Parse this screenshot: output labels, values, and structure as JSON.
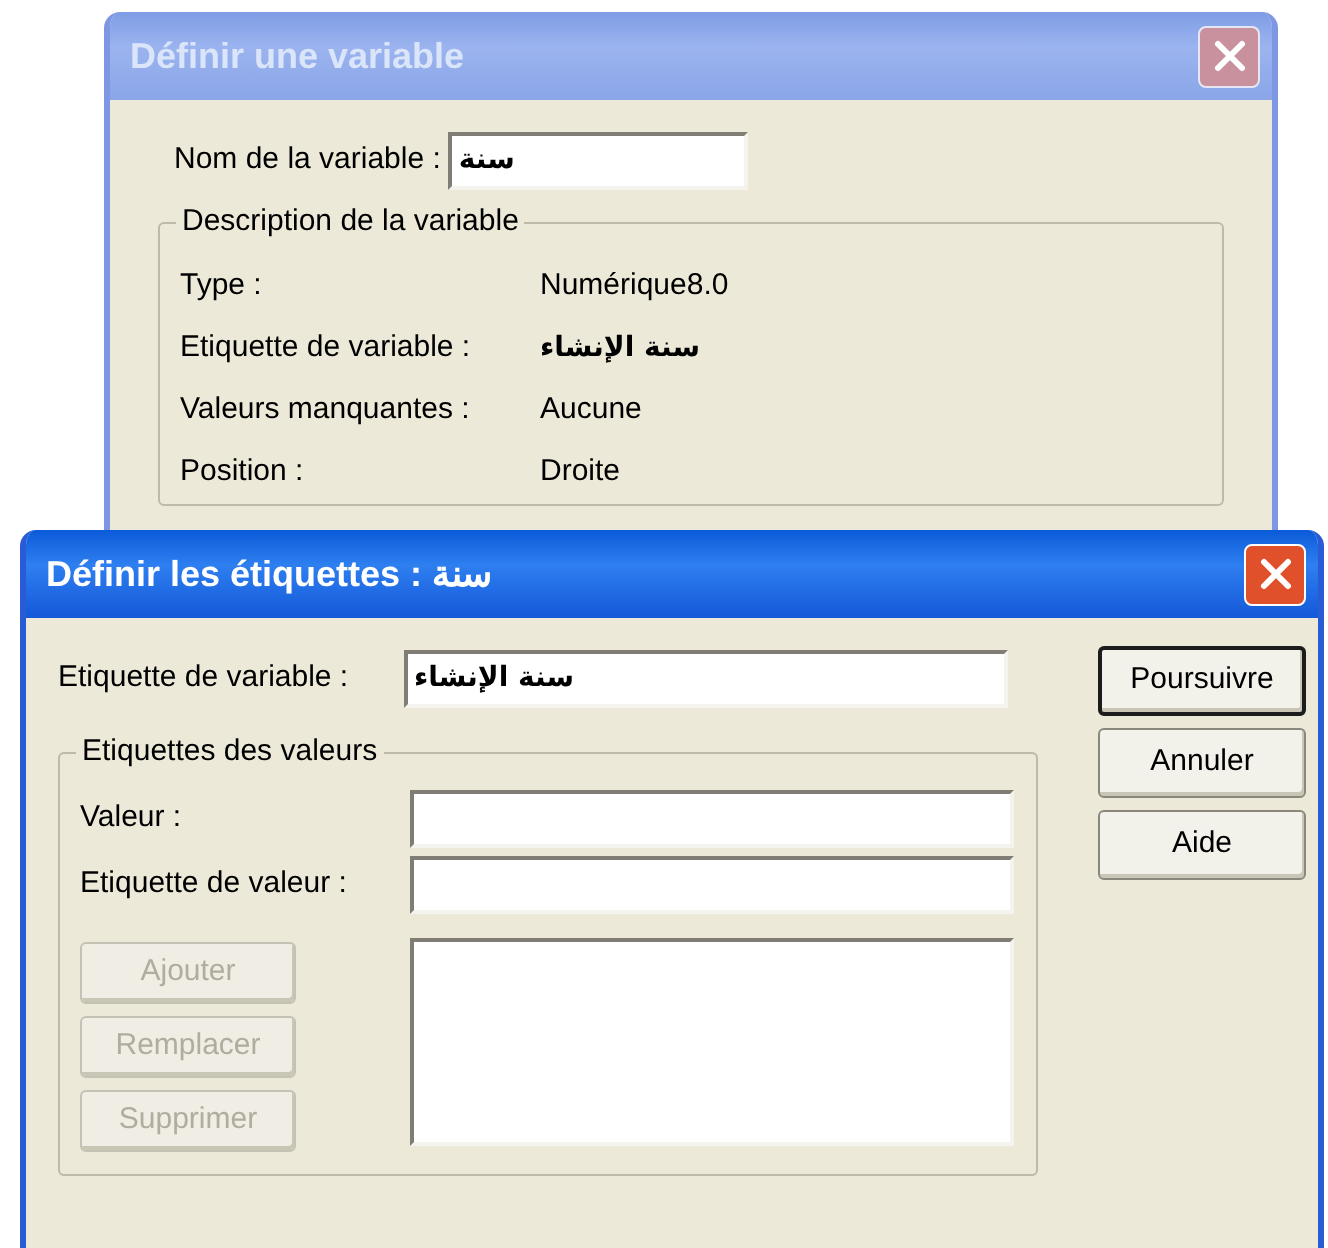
{
  "variable_dialog": {
    "title": "Définir une variable",
    "active": false,
    "name_field": {
      "label": "Nom de la variable :",
      "value": "سنة"
    },
    "description": {
      "legend": "Description de la variable",
      "rows": [
        {
          "label": "Type :",
          "value": "Numérique8.0"
        },
        {
          "label": "Etiquette de variable :",
          "value": "سنة الإنشاء"
        },
        {
          "label": "Valeurs manquantes :",
          "value": "Aucune"
        },
        {
          "label": "Position :",
          "value": "Droite"
        }
      ]
    }
  },
  "labels_dialog": {
    "title": "Définir les étiquettes : سنة",
    "active": true,
    "variable_label": {
      "label": "Etiquette de variable :",
      "value": "سنة الإنشاء"
    },
    "value_labels": {
      "legend": "Etiquettes des valeurs",
      "fields": [
        {
          "label": "Valeur :"
        },
        {
          "label": "Etiquette de valeur :"
        }
      ],
      "buttons": [
        {
          "label": "Ajouter",
          "disabled": true
        },
        {
          "label": "Remplacer",
          "disabled": true
        },
        {
          "label": "Supprimer",
          "disabled": true
        }
      ]
    },
    "buttons": [
      {
        "label": "Poursuivre",
        "default": true
      },
      {
        "label": "Annuler",
        "default": false
      },
      {
        "label": "Aide",
        "default": false
      }
    ]
  }
}
